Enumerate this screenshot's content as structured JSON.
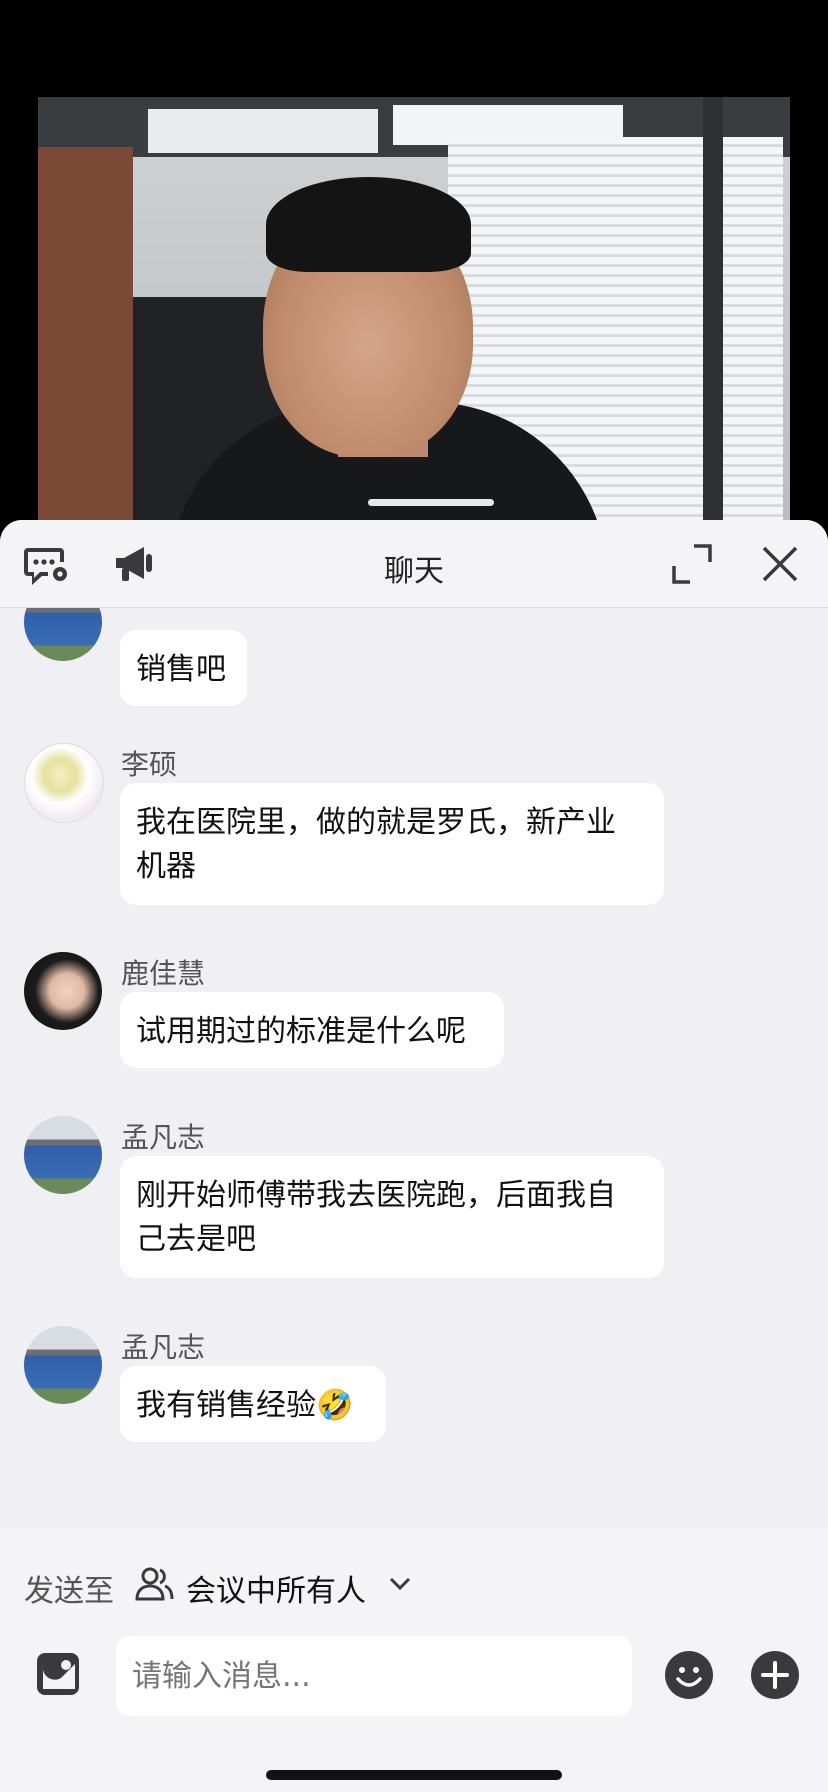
{
  "chat": {
    "title": "聊天"
  },
  "messages": [
    {
      "sender": "",
      "text": "销售吧"
    },
    {
      "sender": "李硕",
      "text": "我在医院里，做的就是罗氏，新产业\n机器"
    },
    {
      "sender": "鹿佳慧",
      "text": "试用期过的标准是什么呢"
    },
    {
      "sender": "孟凡志",
      "text": "刚开始师傅带我去医院跑，后面我自\n己去是吧"
    },
    {
      "sender": "孟凡志",
      "text": "我有销售经验🤣"
    }
  ],
  "composer": {
    "send_to_label": "发送至",
    "send_to_target": "会议中所有人",
    "input_placeholder": "请输入消息..."
  },
  "colors": {
    "sheet_bg": "#efeff4",
    "bubble_bg": "#ffffff",
    "icon_color": "#3a3a3c"
  }
}
